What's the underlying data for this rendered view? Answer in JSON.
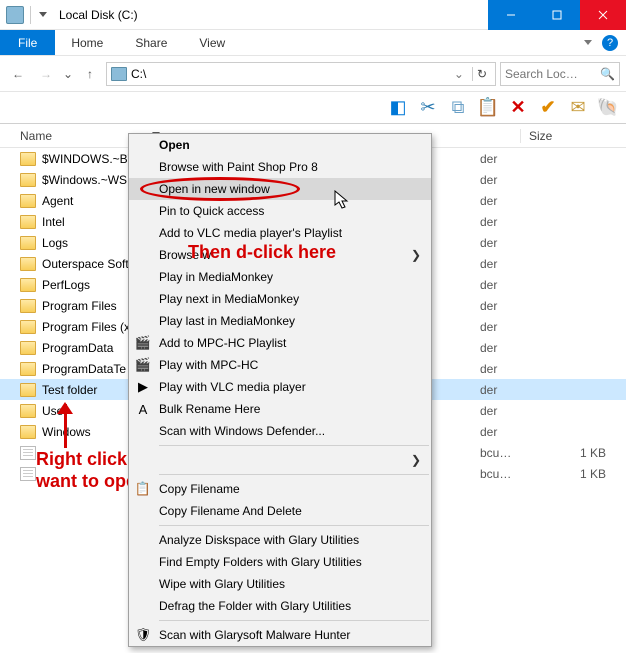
{
  "titlebar": {
    "title": "Local Disk (C:)"
  },
  "ribbon": {
    "file": "File",
    "tabs": [
      "Home",
      "Share",
      "View"
    ]
  },
  "nav": {
    "path": "C:\\",
    "search_placeholder": "Search Loc…"
  },
  "columns": {
    "name": "Name",
    "size": "Size"
  },
  "rows": [
    {
      "icon": "folder",
      "name": "$WINDOWS.~BT",
      "meta": "der",
      "size": ""
    },
    {
      "icon": "folder",
      "name": "$Windows.~WS",
      "meta": "der",
      "size": ""
    },
    {
      "icon": "folder",
      "name": "Agent",
      "meta": "der",
      "size": ""
    },
    {
      "icon": "folder",
      "name": "Intel",
      "meta": "der",
      "size": ""
    },
    {
      "icon": "folder",
      "name": "Logs",
      "meta": "der",
      "size": ""
    },
    {
      "icon": "folder",
      "name": "Outerspace Soft",
      "meta": "der",
      "size": ""
    },
    {
      "icon": "folder",
      "name": "PerfLogs",
      "meta": "der",
      "size": ""
    },
    {
      "icon": "folder",
      "name": "Program Files",
      "meta": "der",
      "size": ""
    },
    {
      "icon": "folder",
      "name": "Program Files (x",
      "meta": "der",
      "size": ""
    },
    {
      "icon": "folder",
      "name": "ProgramData",
      "meta": "der",
      "size": ""
    },
    {
      "icon": "folder",
      "name": "ProgramDataTe",
      "meta": "der",
      "size": ""
    },
    {
      "icon": "folder",
      "name": "Test folder",
      "meta": "der",
      "size": "",
      "selected": true
    },
    {
      "icon": "folder",
      "name": "Use",
      "meta": "der",
      "size": ""
    },
    {
      "icon": "folder",
      "name": "Windows",
      "meta": "der",
      "size": ""
    },
    {
      "icon": "file",
      "name": "",
      "meta": "bcu…",
      "size": "1 KB"
    },
    {
      "icon": "file",
      "name": "",
      "meta": "bcu…",
      "size": "1 KB"
    }
  ],
  "context_menu": [
    {
      "type": "item",
      "label": "Open",
      "bold": true
    },
    {
      "type": "item",
      "label": "Browse with Paint Shop Pro 8"
    },
    {
      "type": "item",
      "label": "Open in new window",
      "hover": true
    },
    {
      "type": "item",
      "label": "Pin to Quick access"
    },
    {
      "type": "item",
      "label": "Add to VLC media player's Playlist"
    },
    {
      "type": "item",
      "label": "Browse w",
      "submenu": true
    },
    {
      "type": "item",
      "label": "Play in MediaMonkey"
    },
    {
      "type": "item",
      "label": "Play next in MediaMonkey"
    },
    {
      "type": "item",
      "label": "Play last in MediaMonkey"
    },
    {
      "type": "item",
      "label": "Add to MPC-HC Playlist",
      "icon": "🎬"
    },
    {
      "type": "item",
      "label": "Play with MPC-HC",
      "icon": "🎬"
    },
    {
      "type": "item",
      "label": "Play with VLC media player",
      "icon": "▶"
    },
    {
      "type": "item",
      "label": "Bulk Rename Here",
      "icon": "A"
    },
    {
      "type": "item",
      "label": "Scan with Windows Defender..."
    },
    {
      "type": "sep"
    },
    {
      "type": "item",
      "label": "",
      "submenu": true
    },
    {
      "type": "sep"
    },
    {
      "type": "item",
      "label": "Copy Filename",
      "icon": "📋"
    },
    {
      "type": "item",
      "label": "Copy Filename And Delete"
    },
    {
      "type": "sep"
    },
    {
      "type": "item",
      "label": "Analyze Diskspace with Glary Utilities"
    },
    {
      "type": "item",
      "label": "Find Empty Folders with Glary Utilities"
    },
    {
      "type": "item",
      "label": "Wipe with Glary Utilities"
    },
    {
      "type": "item",
      "label": "Defrag the Folder with Glary Utilities"
    },
    {
      "type": "sep"
    },
    {
      "type": "item",
      "label": "Scan with Glarysoft Malware Hunter",
      "icon": "🛡"
    }
  ],
  "annotations": {
    "click_hint": "Then d-click here",
    "rclick_hint": "Right click the folder you\nwant to open"
  }
}
